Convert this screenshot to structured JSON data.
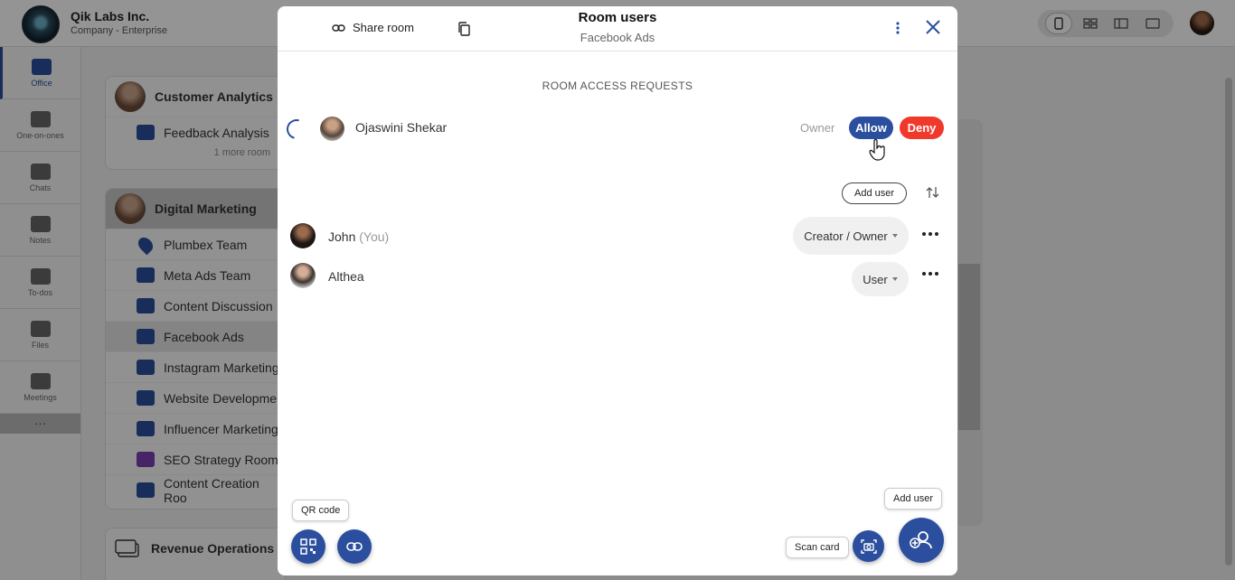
{
  "org": {
    "name": "Qik Labs Inc.",
    "type": "Company - Enterprise"
  },
  "nav": [
    {
      "label": "Office",
      "icon": "briefcase-icon",
      "active": true
    },
    {
      "label": "One-on-ones",
      "icon": "people-icon"
    },
    {
      "label": "Chats",
      "icon": "chat-icon"
    },
    {
      "label": "Notes",
      "icon": "notes-icon"
    },
    {
      "label": "To-dos",
      "icon": "checkbox-icon"
    },
    {
      "label": "Files",
      "icon": "files-icon"
    },
    {
      "label": "Meetings",
      "icon": "meetings-icon"
    }
  ],
  "nav_more": "…",
  "rooms": {
    "customer_analytics": {
      "title": "Customer Analytics",
      "rooms": [
        "Feedback Analysis"
      ],
      "more": "1 more room"
    },
    "digital_marketing": {
      "title": "Digital Marketing",
      "rooms": [
        "Plumbex Team",
        "Meta Ads Team",
        "Content Discussion",
        "Facebook Ads",
        "Instagram Marketing",
        "Website Developmen",
        "Influencer Marketing",
        "SEO Strategy Room",
        "Content Creation Roo"
      ]
    },
    "revenue_operations": {
      "title": "Revenue Operations"
    }
  },
  "modal": {
    "share_room": "Share room",
    "title": "Room users",
    "subtitle": "Facebook Ads",
    "requests_title": "ROOM ACCESS REQUESTS",
    "request": {
      "name": "Ojaswini Shekar",
      "role": "Owner",
      "allow": "Allow",
      "deny": "Deny"
    },
    "add_user_label": "Add user",
    "users": [
      {
        "name": "John",
        "you": "(You)",
        "role": "Creator / Owner"
      },
      {
        "name": "Althea",
        "role": "User"
      }
    ],
    "tooltips": {
      "qr": "QR code",
      "scan": "Scan card",
      "add": "Add user"
    }
  },
  "colors": {
    "primary": "#2b4f9e",
    "deny": "#f0392b"
  }
}
